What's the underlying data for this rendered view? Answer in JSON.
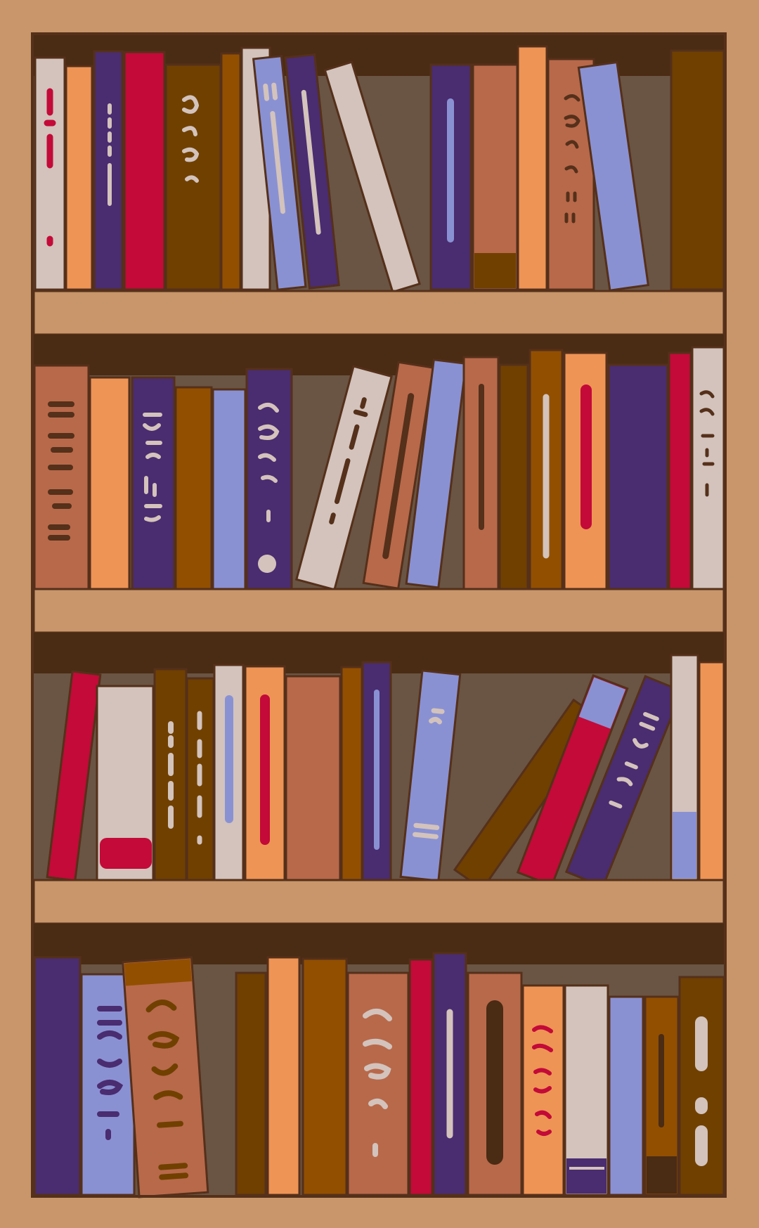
{
  "image": {
    "subject": "bookshelf-illustration"
  },
  "palette": {
    "wood_light": "#C8966A",
    "frame_outline": "#55301A",
    "shelf_shadow": "#4A2B14",
    "back_panel": "#6A5544",
    "book_cream": "#D3C3BC",
    "book_orange": "#EE9455",
    "book_purple": "#4A2C70",
    "book_red": "#C30A38",
    "book_brown": "#704000",
    "book_terracotta": "#B8694A",
    "book_lavender": "#8A91D3",
    "book_rust": "#924F00",
    "book_dark_brown": "#55301A"
  },
  "shelves": [
    {
      "name": "shelf-1",
      "book_count": 17
    },
    {
      "name": "shelf-2",
      "book_count": 16
    },
    {
      "name": "shelf-3",
      "book_count": 16
    },
    {
      "name": "shelf-4",
      "book_count": 16
    }
  ]
}
